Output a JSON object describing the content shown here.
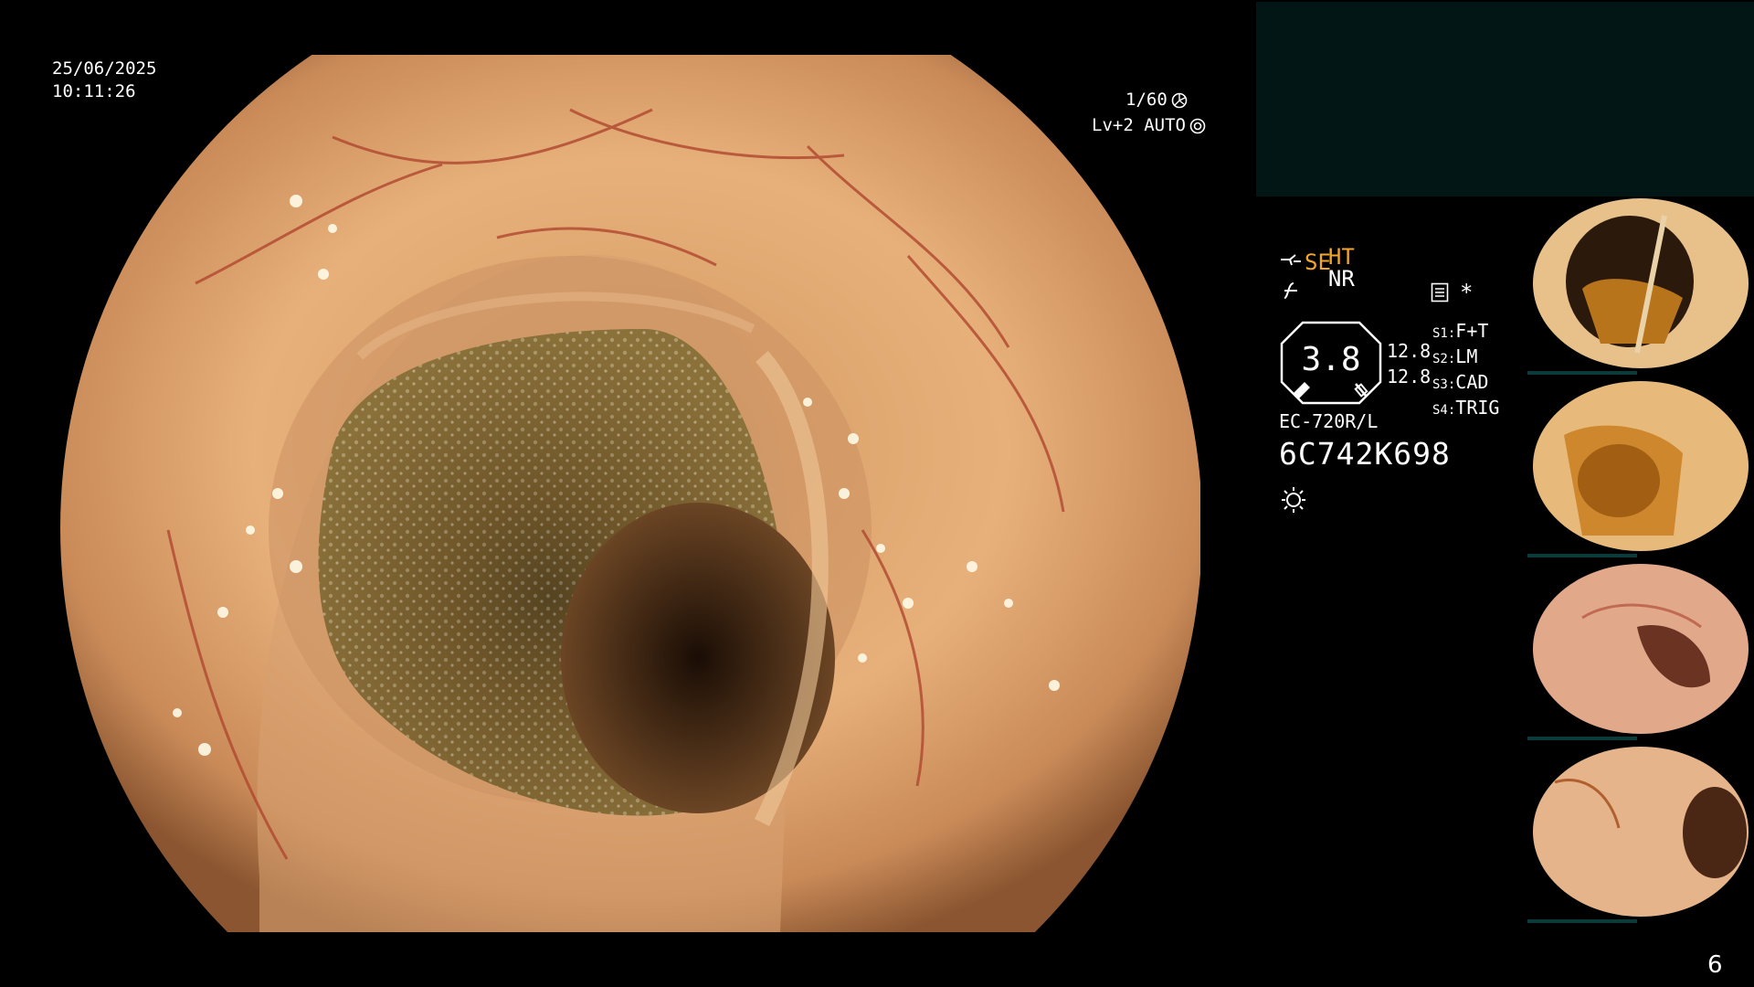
{
  "overlay": {
    "date": "25/06/2025",
    "time": "10:11:26",
    "shutter": "1/60",
    "level": "Lv+2 AUTO"
  },
  "panel": {
    "mode_ht": "HT",
    "mode_nr": "NR",
    "mode_se": "SE",
    "asterisk": "*",
    "gauge_value": "3.8",
    "stat_1": "12.8",
    "stat_2": "12.8",
    "switches": [
      {
        "key": "S1:",
        "value": "F+T"
      },
      {
        "key": "S2:",
        "value": "LM"
      },
      {
        "key": "S3:",
        "value": "CAD"
      },
      {
        "key": "S4:",
        "value": "TRIG"
      }
    ],
    "scope_model": "EC-720R/L",
    "scope_serial": "6C742K698"
  },
  "thumbnails_meta": {
    "serial_label": "6C742K698"
  },
  "page_number": "6",
  "colors": {
    "accent_orange": "#f2a72b",
    "panel_dark": "#021615",
    "background": "#000000"
  },
  "icons": [
    "shutter-icon",
    "auto-icon",
    "scope-se-icon",
    "freeze-icon",
    "memo-icon",
    "light-icon"
  ]
}
